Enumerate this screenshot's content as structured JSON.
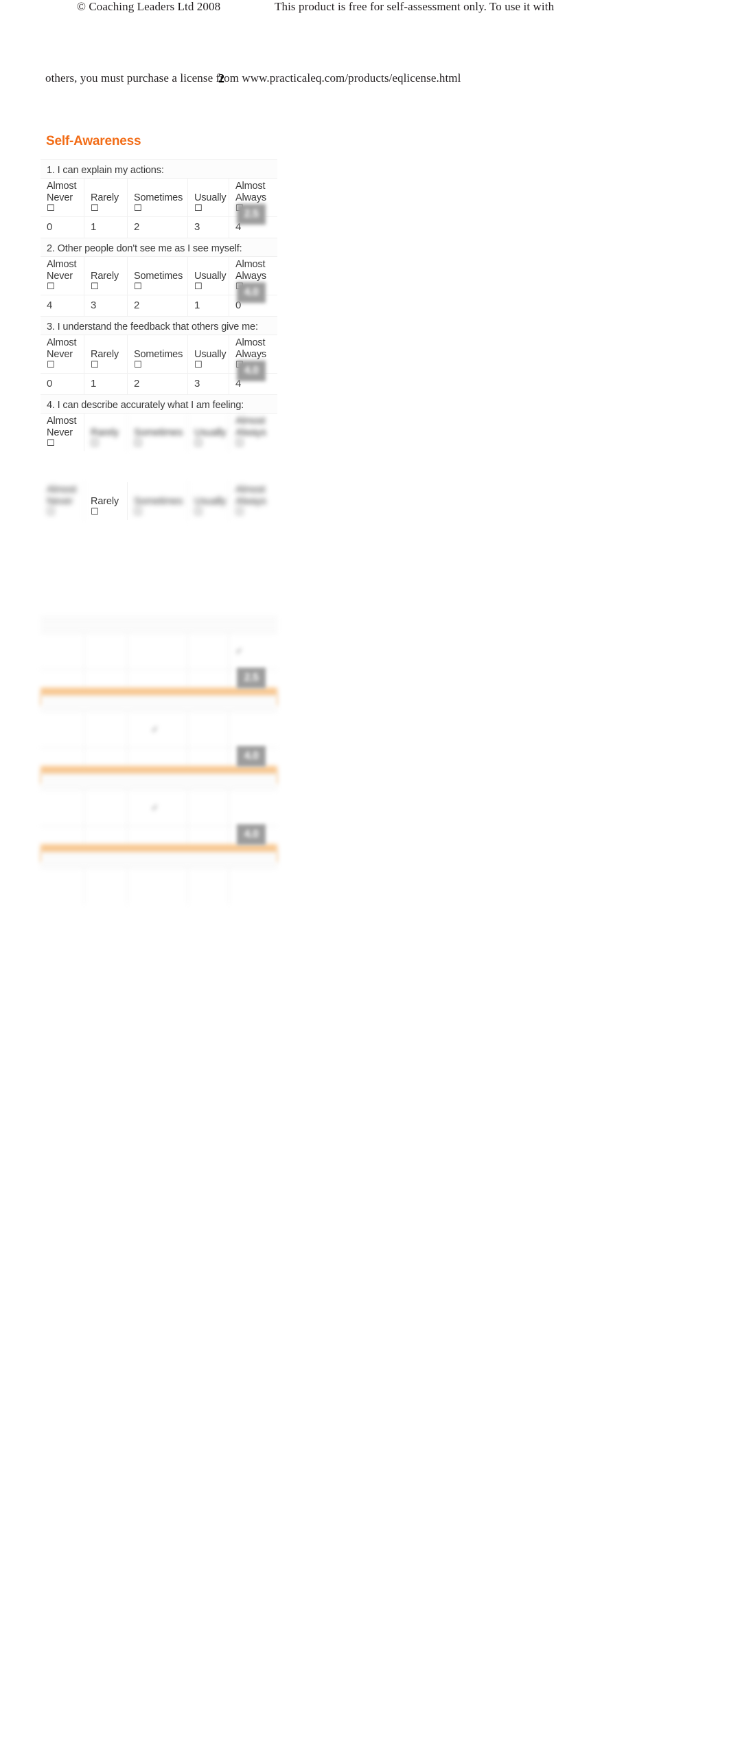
{
  "document": {
    "copyright": "© Coaching Leaders Ltd 2008",
    "license_line_1": "This product is free for self-assessment only. To use it with",
    "license_line_2": "others, you must purchase a license from www.practicaleq.com/products/eqlicense.html",
    "page_number": "2"
  },
  "section": {
    "heading": "Self-Awareness",
    "heading_color": "#F26C16",
    "accent_bar_color": "#F8C891"
  },
  "scale": {
    "labels": [
      {
        "line1": "Almost",
        "line2": "Never"
      },
      {
        "line1": "",
        "line2": "Rarely"
      },
      {
        "line1": "",
        "line2": "Sometimes"
      },
      {
        "line1": "",
        "line2": "Usually"
      },
      {
        "line1": "Almost",
        "line2": "Always"
      }
    ],
    "checkbox_glyph": "☐"
  },
  "questions": [
    {
      "number": "1.",
      "text": "1. I can explain my actions:",
      "scores": [
        "0",
        "1",
        "2",
        "3",
        "4"
      ],
      "badge": "2.5"
    },
    {
      "number": "2.",
      "text": "2. Other people don't see me as I see myself:",
      "scores": [
        "4",
        "3",
        "2",
        "1",
        "0"
      ],
      "badge": "4.0"
    },
    {
      "number": "3.",
      "text": "3. I understand the feedback that others give me:",
      "scores": [
        "0",
        "1",
        "2",
        "3",
        "4"
      ],
      "badge": "4.0"
    },
    {
      "number": "4.",
      "text": "4. I can describe accurately what I am feeling:",
      "scores": [
        "",
        "",
        "",
        "",
        ""
      ],
      "badge": ""
    }
  ],
  "obscured_rows": [
    {
      "badge": "2.5"
    },
    {
      "badge": "4.0"
    },
    {
      "badge": "4.0"
    }
  ]
}
